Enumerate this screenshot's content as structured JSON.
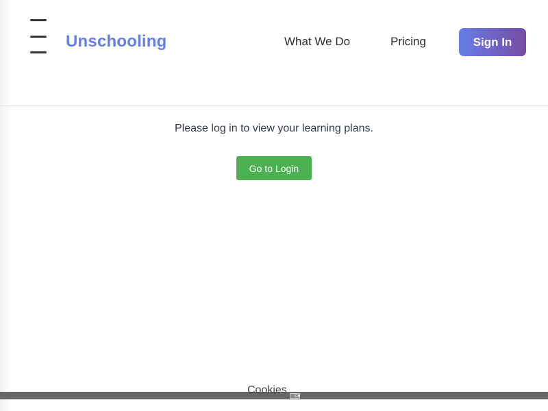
{
  "header": {
    "brand": "Unschooling",
    "nav": {
      "what_we_do": "What We Do",
      "pricing": "Pricing"
    },
    "sign_in_label": "Sign In",
    "menu_icon": "hamburger-menu-icon"
  },
  "main": {
    "message": "Please log in to view your learning plans.",
    "login_button_label": "Go to Login"
  },
  "cookie_banner": {
    "text": "Cookies",
    "ok_label": "OK"
  },
  "colors": {
    "brand": "#667eea",
    "sign_in_gradient_start": "#667eea",
    "sign_in_gradient_end": "#764ba2",
    "login_button": "#4caf50",
    "cookie_bar": "#676767"
  }
}
